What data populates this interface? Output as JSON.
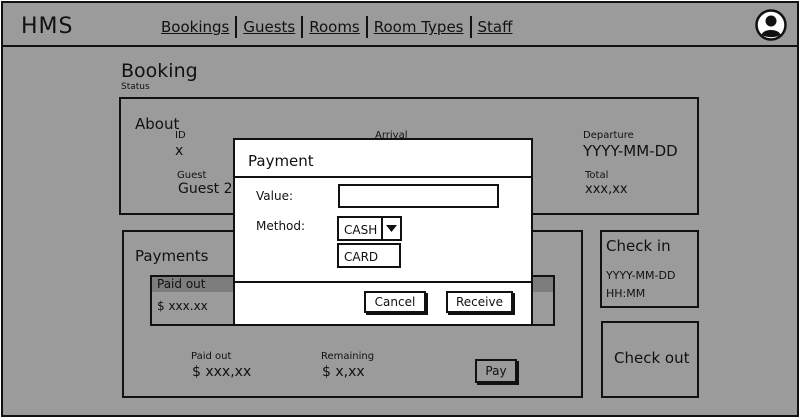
{
  "app": {
    "logo": "HMS"
  },
  "nav": {
    "items": [
      "Bookings",
      "Guests",
      "Rooms",
      "Room Types",
      "Staff"
    ]
  },
  "page": {
    "title": "Booking",
    "subtitle": "Status"
  },
  "about": {
    "title": "About",
    "id_label": "ID",
    "id_value": "x",
    "arrival_label": "Arrival",
    "departure_label": "Departure",
    "departure_value": "YYYY-MM-DD",
    "guest_label": "Guest",
    "guest_value": "Guest 2",
    "total_label": "Total",
    "total_value": "xxx,xx"
  },
  "payments": {
    "title": "Payments",
    "table_header": "Paid out",
    "table_row_value": "$ xxx.xx",
    "paid_out_label": "Paid out",
    "paid_out_value": "$ xxx,xx",
    "remaining_label": "Remaining",
    "remaining_value": "$ x,xx",
    "pay_button": "Pay"
  },
  "checkin": {
    "title": "Check in",
    "date": "YYYY-MM-DD",
    "time": "HH:MM"
  },
  "checkout": {
    "title": "Check out"
  },
  "dialog": {
    "title": "Payment",
    "value_label": "Value:",
    "value_input": "",
    "method_label": "Method:",
    "method_selected": "CASH",
    "method_options": [
      "CARD"
    ],
    "cancel_button": "Cancel",
    "receive_button": "Receive"
  },
  "icons": {
    "avatar": "user-avatar-icon",
    "dropdown": "caret-down-icon"
  },
  "colors": {
    "overlay": "#9b9b9b",
    "dialog": "#ffffff",
    "border": "#111111"
  }
}
